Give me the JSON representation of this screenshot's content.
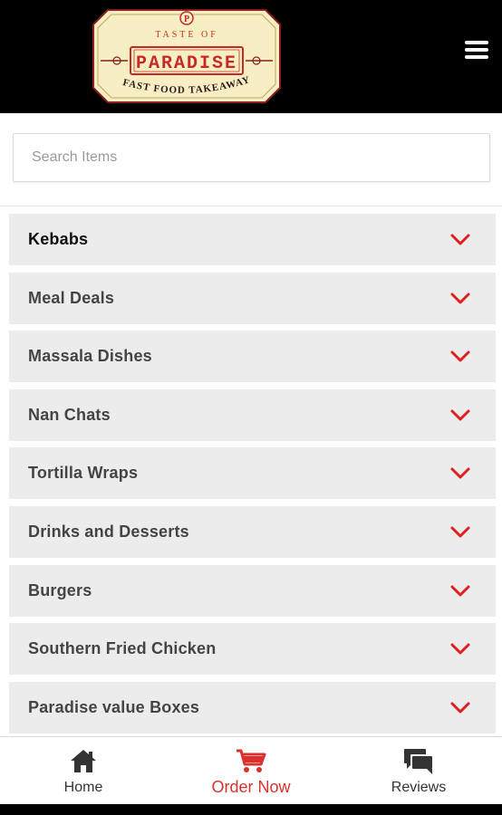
{
  "header": {
    "logo": {
      "line1": "TASTE OF",
      "brand": "PARADISE",
      "line2": "FAST FOOD TAKEAWAY",
      "colors": {
        "bg": "#f7efc4",
        "red": "#c8282c",
        "border": "#8a1d1d"
      }
    },
    "menu_icon": "hamburger-menu-icon"
  },
  "search": {
    "placeholder": "Search Items",
    "value": ""
  },
  "categories": [
    {
      "label": "Kebabs"
    },
    {
      "label": "Meal Deals"
    },
    {
      "label": "Massala Dishes"
    },
    {
      "label": "Nan Chats"
    },
    {
      "label": "Tortilla Wraps"
    },
    {
      "label": "Drinks and Desserts"
    },
    {
      "label": "Burgers"
    },
    {
      "label": "Southern Fried Chicken"
    },
    {
      "label": "Paradise value Boxes"
    }
  ],
  "bottom_nav": {
    "home": {
      "label": "Home",
      "icon": "home-icon"
    },
    "order": {
      "label": "Order Now",
      "icon": "cart-icon",
      "active": true
    },
    "reviews": {
      "label": "Reviews",
      "icon": "chat-bubbles-icon"
    }
  },
  "colors": {
    "accent": "#d9312b",
    "chevron": "#e02020",
    "item_bg": "#ececec"
  }
}
